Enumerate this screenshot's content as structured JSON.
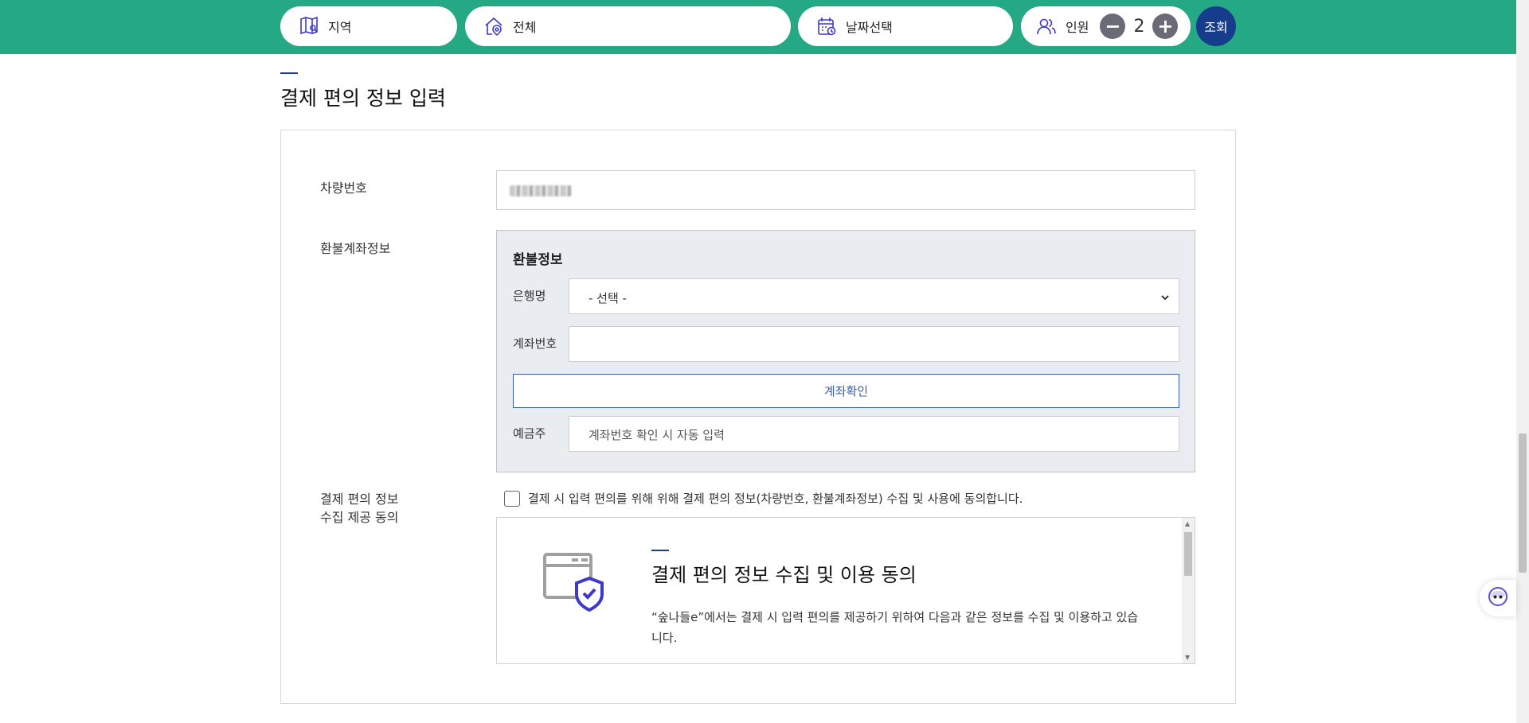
{
  "topbar": {
    "region_label": "지역",
    "all_label": "전체",
    "date_label": "날짜선택",
    "people_label": "인원",
    "people_count": "2",
    "minus": "−",
    "plus": "+",
    "search_label": "조회"
  },
  "section": {
    "title": "결제 편의 정보 입력"
  },
  "form": {
    "car_label": "차량번호",
    "refund_label": "환불계좌정보",
    "refund": {
      "title": "환불정보",
      "bank_label": "은행명",
      "bank_selected": "- 선택 -",
      "account_label": "계좌번호",
      "account_value": "",
      "confirm_button": "계좌확인",
      "holder_label": "예금주",
      "holder_placeholder": "계좌번호 확인 시 자동 입력"
    },
    "consent_label_line1": "결제 편의 정보",
    "consent_label_line2": "수집 제공 동의",
    "agree_text": "결제 시 입력 편의를 위해 위해 결제 편의 정보(차량번호, 환불계좌정보) 수집 및 사용에 동의합니다.",
    "consent_box": {
      "title": "결제 편의 정보 수집 및 이용 동의",
      "text": "“숲나들e”에서는 결제 시 입력 편의를 제공하기 위하여 다음과 같은 정보를 수집 및 이용하고 있습니다."
    }
  },
  "icons": {
    "region": "map-icon",
    "all": "home-location-icon",
    "date": "calendar-icon",
    "people": "people-icon",
    "chat": "chatbot-icon"
  },
  "colors": {
    "topbar": "#25a884",
    "navy": "#163d8c",
    "shield": "#3d3acb"
  }
}
